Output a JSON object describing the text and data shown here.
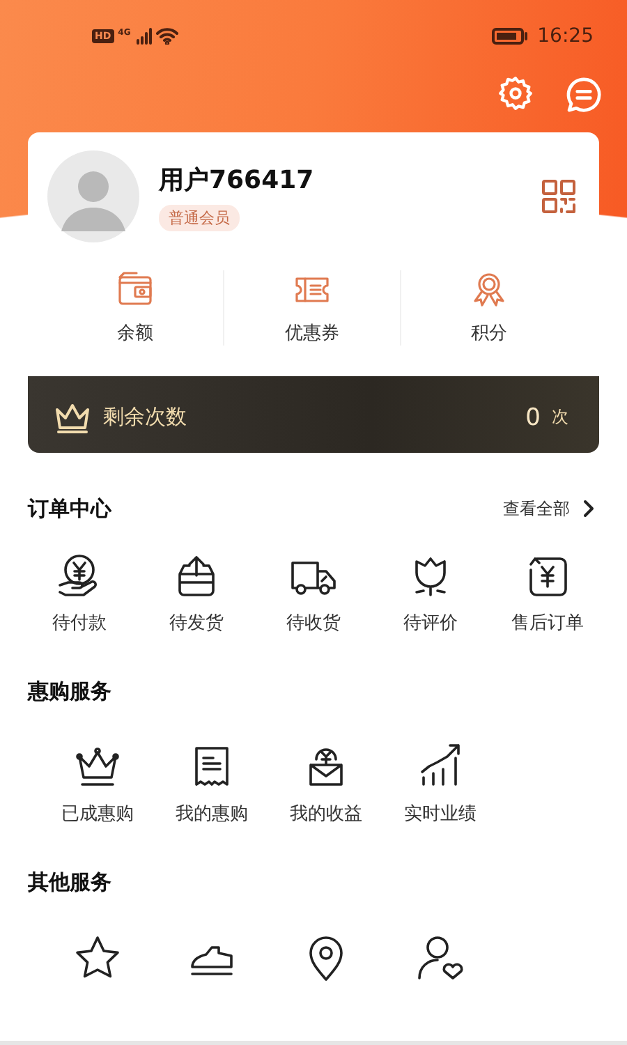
{
  "status_bar": {
    "hd": "HD",
    "network": "4G",
    "time": "16:25"
  },
  "profile": {
    "username": "用户766417",
    "member_level": "普通会员"
  },
  "assets": [
    {
      "label": "余额"
    },
    {
      "label": "优惠券"
    },
    {
      "label": "积分"
    }
  ],
  "remaining": {
    "label": "剩余次数",
    "count": "0",
    "unit": "次"
  },
  "orders": {
    "title": "订单中心",
    "view_all": "查看全部",
    "items": [
      {
        "label": "待付款"
      },
      {
        "label": "待发货"
      },
      {
        "label": "待收货"
      },
      {
        "label": "待评价"
      },
      {
        "label": "售后订单"
      }
    ]
  },
  "deal_services": {
    "title": "惠购服务",
    "items": [
      {
        "label": "已成惠购"
      },
      {
        "label": "我的惠购"
      },
      {
        "label": "我的收益"
      },
      {
        "label": "实时业绩"
      }
    ]
  },
  "other_services": {
    "title": "其他服务"
  }
}
